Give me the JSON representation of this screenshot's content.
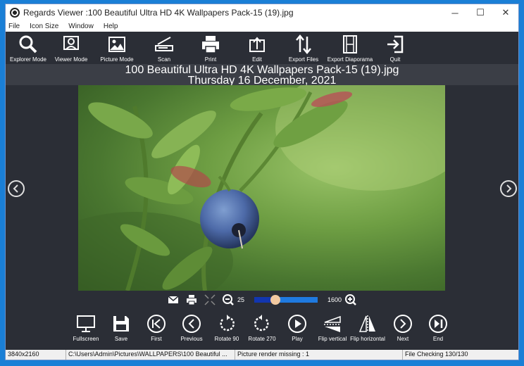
{
  "window": {
    "title": "Regards Viewer :100 Beautiful Ultra HD 4K Wallpapers Pack-15 (19).jpg",
    "minimize": "─",
    "maximize": "☐",
    "close": "✕"
  },
  "menu": [
    "File",
    "Icon Size",
    "Window",
    "Help"
  ],
  "toolbar": [
    {
      "label": "Explorer Mode",
      "icon": "search-icon"
    },
    {
      "label": "Viewer Mode",
      "icon": "viewer-icon"
    },
    {
      "label": "Picture Mode",
      "icon": "picture-icon"
    },
    {
      "label": "Scan",
      "icon": "scanner-icon"
    },
    {
      "label": "Print",
      "icon": "printer-icon"
    },
    {
      "label": "Edit",
      "icon": "edit-icon"
    },
    {
      "label": "Export Files",
      "icon": "export-arrows-icon"
    },
    {
      "label": "Export Diaporama",
      "icon": "film-icon"
    },
    {
      "label": "Quit",
      "icon": "exit-icon"
    }
  ],
  "caption": {
    "filename": "100 Beautiful Ultra HD 4K Wallpapers Pack-15 (19).jpg",
    "date": "Thursday 16 December, 2021"
  },
  "zoom": {
    "min_label": "25",
    "max_label": "1600",
    "level_fraction": 0.33
  },
  "bottombar": [
    {
      "label": "Fullscreen",
      "icon": "monitor-icon"
    },
    {
      "label": "Save",
      "icon": "save-icon"
    },
    {
      "label": "First",
      "icon": "first-icon"
    },
    {
      "label": "Previous",
      "icon": "previous-icon"
    },
    {
      "label": "Rotate 90",
      "icon": "rotate-left-icon"
    },
    {
      "label": "Rotate 270",
      "icon": "rotate-right-icon"
    },
    {
      "label": "Play",
      "icon": "play-icon"
    },
    {
      "label": "Flip vertical",
      "icon": "flip-vertical-icon"
    },
    {
      "label": "Flip horizontal",
      "icon": "flip-horizontal-icon"
    },
    {
      "label": "Next",
      "icon": "next-icon"
    },
    {
      "label": "End",
      "icon": "end-icon"
    }
  ],
  "status": {
    "resolution": "3840x2160",
    "path": "C:\\Users\\Admin\\Pictures\\WALLPAPERS\\100 Beautiful ...",
    "render": "Picture render missing : 1",
    "checking": "File Checking 130/130"
  }
}
